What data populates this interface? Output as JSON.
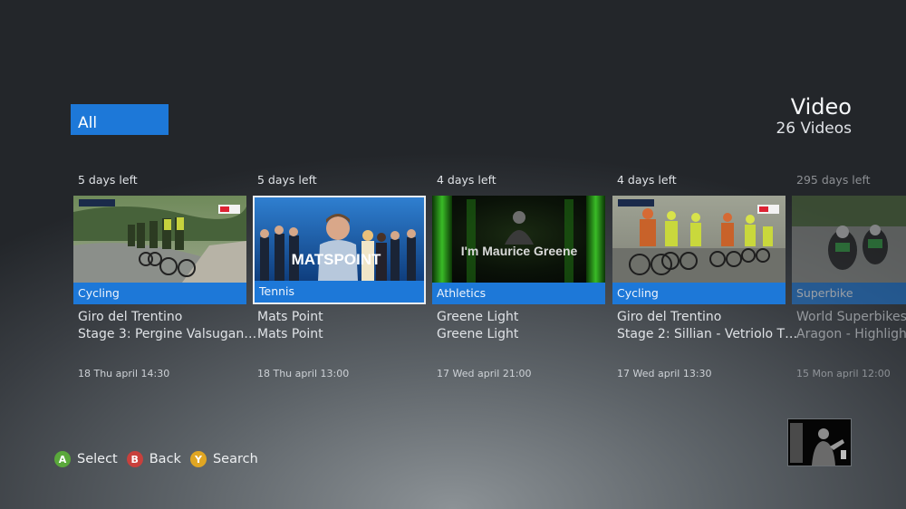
{
  "filter": {
    "label": "All"
  },
  "header": {
    "title": "Video",
    "count": "26 Videos"
  },
  "cards": [
    {
      "days": "5 days left",
      "category": "Cycling",
      "title": "Giro del Trentino",
      "subtitle": "Stage 3: Pergine Valsugan…",
      "date": "18 Thu april 14:30"
    },
    {
      "days": "5 days left",
      "category": "Tennis",
      "title": "Mats Point",
      "subtitle": "Mats Point",
      "date": "18 Thu april 13:00",
      "thumb_text": "MATSPOINT"
    },
    {
      "days": "4 days left",
      "category": "Athletics",
      "title": "Greene Light",
      "subtitle": "Greene Light",
      "date": "17 Wed april 21:00",
      "thumb_text": "I'm Maurice Greene"
    },
    {
      "days": "4 days left",
      "category": "Cycling",
      "title": "Giro del Trentino",
      "subtitle": "Stage 2: Sillian - Vetriolo T…",
      "date": "17 Wed april 13:30"
    },
    {
      "days": "295 days left",
      "category": "Superbike",
      "title": "World Superbikes",
      "subtitle": "Aragon - Highlights",
      "date": "15 Mon april 12:00"
    }
  ],
  "hints": {
    "a_glyph": "A",
    "a_label": "Select",
    "b_glyph": "B",
    "b_label": "Back",
    "y_glyph": "Y",
    "y_label": "Search"
  },
  "colors": {
    "accent": "#1d78d8",
    "button_a": "#5aa83b",
    "button_b": "#c8403c",
    "button_y": "#e0a623"
  }
}
